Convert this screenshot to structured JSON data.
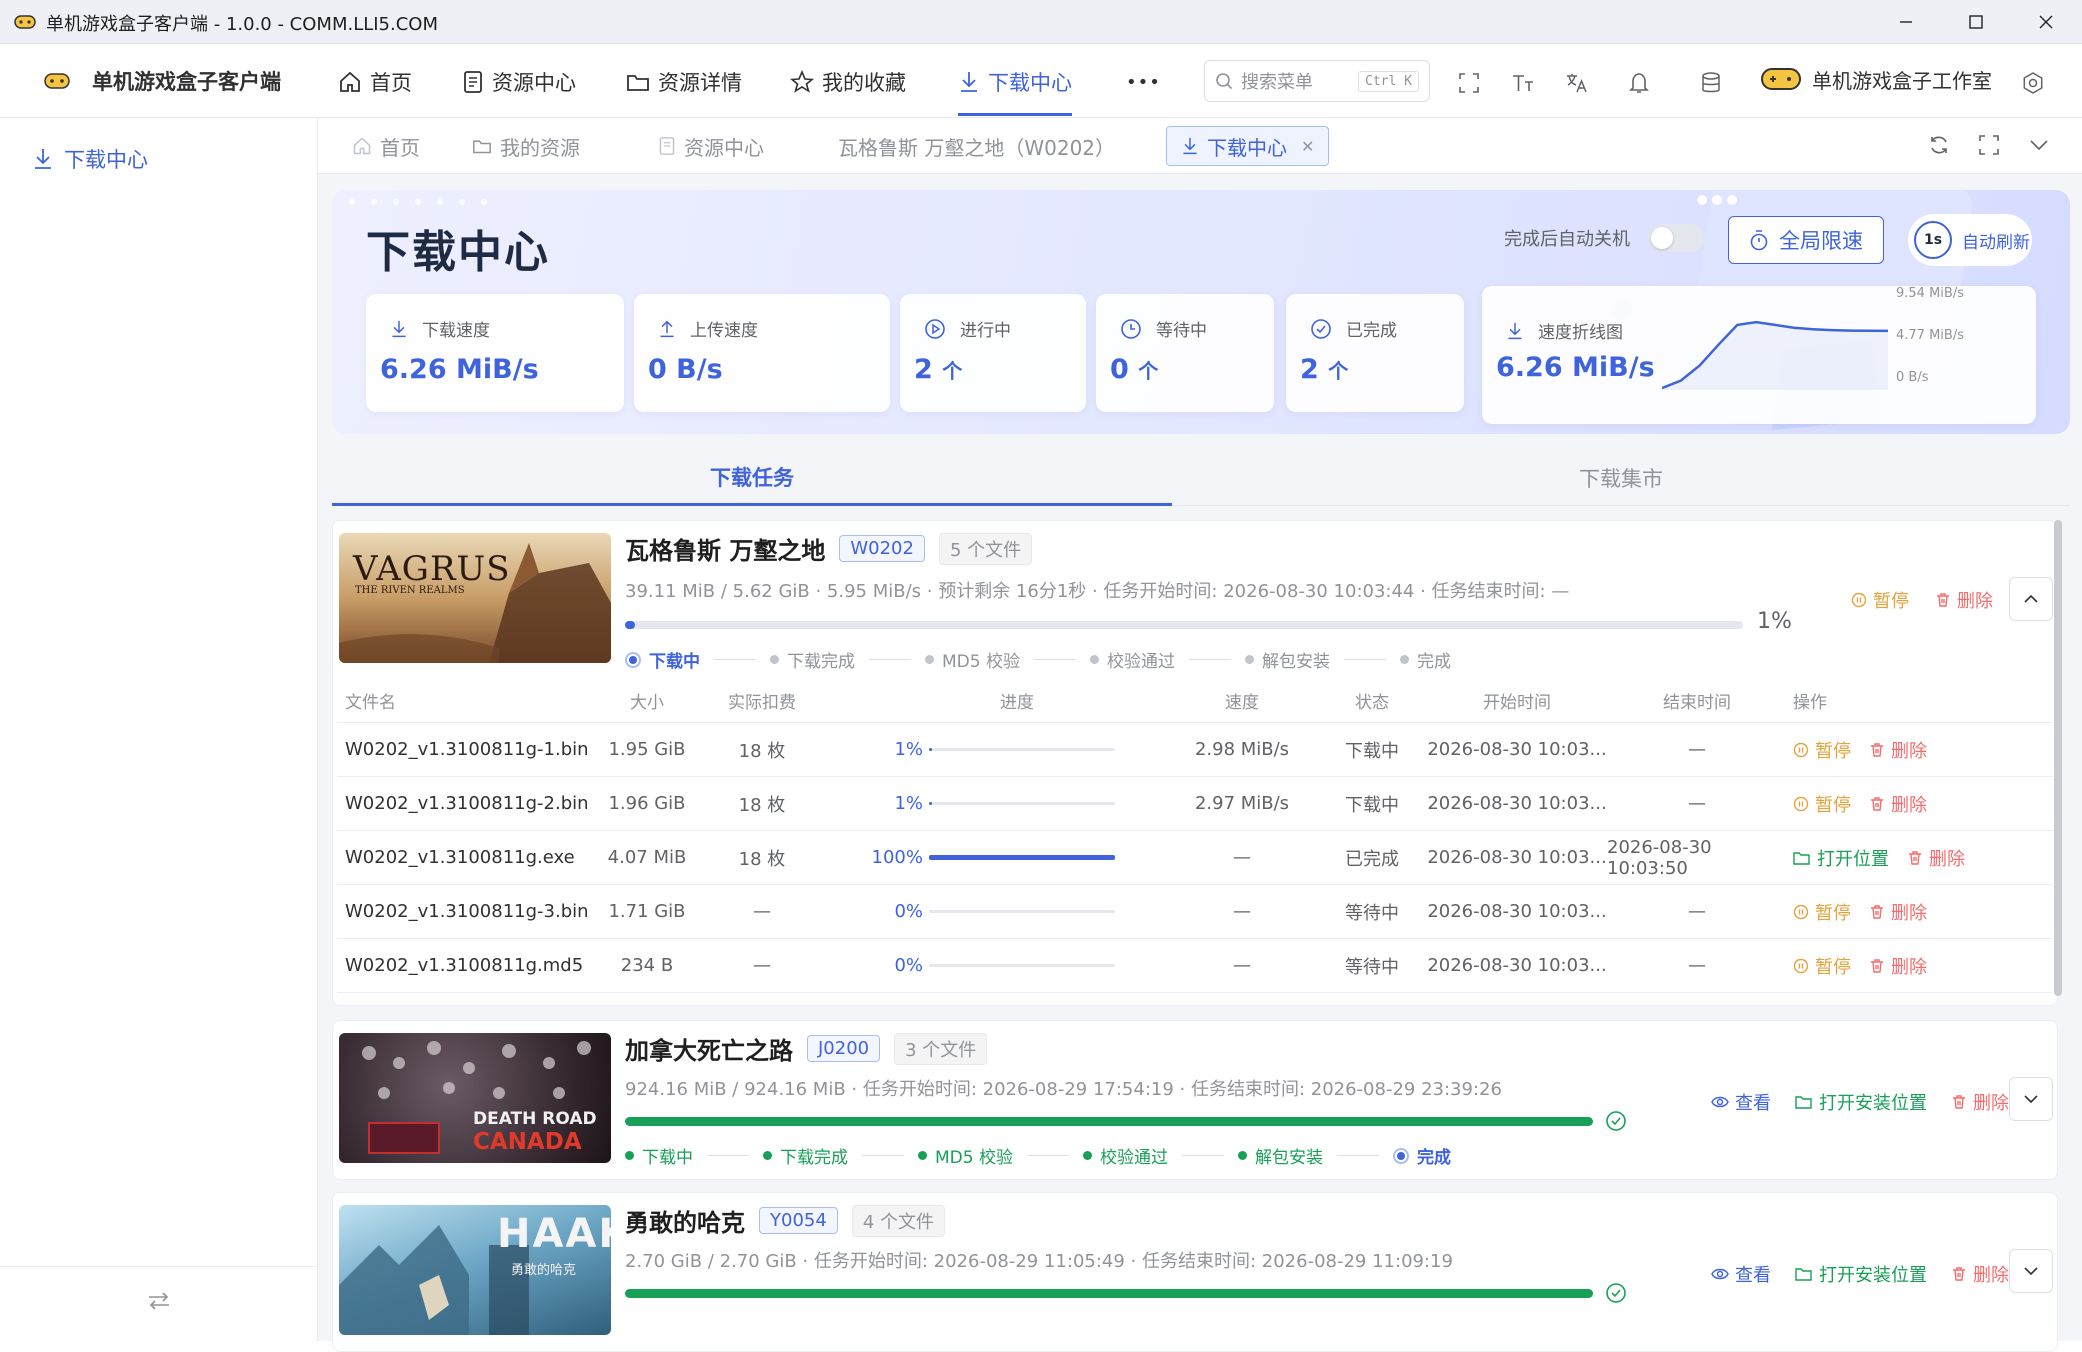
{
  "window": {
    "title": "单机游戏盒子客户端 - 1.0.0 - COMM.LLI5.COM"
  },
  "header": {
    "app_name": "单机游戏盒子客户端",
    "nav": [
      {
        "label": "首页",
        "icon": "home-icon"
      },
      {
        "label": "资源中心",
        "icon": "document-icon"
      },
      {
        "label": "资源详情",
        "icon": "folder-icon"
      },
      {
        "label": "我的收藏",
        "icon": "star-icon"
      },
      {
        "label": "下载中心",
        "icon": "download-icon",
        "active": true
      }
    ],
    "more": "•••",
    "search_placeholder": "搜索菜单",
    "search_shortcut": "Ctrl K",
    "studio_name": "单机游戏盒子工作室"
  },
  "sidebar": {
    "items": [
      {
        "label": "下载中心",
        "icon": "download-icon"
      }
    ]
  },
  "page_tabs": [
    {
      "label": "首页"
    },
    {
      "label": "我的资源"
    },
    {
      "label": "资源中心"
    },
    {
      "label": "瓦格鲁斯 万壑之地（W0202）"
    },
    {
      "label": "下载中心",
      "active": true
    }
  ],
  "hero": {
    "title": "下载中心",
    "auto_shutdown_label": "完成后自动关机",
    "auto_shutdown_on": false,
    "limit_button": "全局限速",
    "refresh_interval": "1s",
    "refresh_label": "自动刷新",
    "stats": {
      "download_speed": {
        "label": "下载速度",
        "value": "6.26 MiB/s"
      },
      "upload_speed": {
        "label": "上传速度",
        "value": "0 B/s"
      },
      "in_progress": {
        "label": "进行中",
        "value": "2",
        "unit": "个"
      },
      "waiting": {
        "label": "等待中",
        "value": "0",
        "unit": "个"
      },
      "completed": {
        "label": "已完成",
        "value": "2",
        "unit": "个"
      }
    },
    "speed_chart": {
      "label": "速度折线图",
      "value": "6.26 MiB/s",
      "ticks": [
        "9.54 MiB/s",
        "4.77 MiB/s",
        "0 B/s"
      ]
    }
  },
  "chart_data": {
    "type": "line",
    "title": "速度折线图",
    "yticks": [
      "9.54 MiB/s",
      "4.77 MiB/s",
      "0 B/s"
    ],
    "ylim": [
      0,
      9.54
    ],
    "series": [
      {
        "values": [
          0.2,
          1.0,
          2.6,
          4.8,
          6.9,
          7.2,
          6.9,
          6.6,
          6.45,
          6.35,
          6.3,
          6.28,
          6.26
        ]
      }
    ]
  },
  "section_tabs": [
    {
      "label": "下载任务",
      "active": true
    },
    {
      "label": "下载集市"
    }
  ],
  "step_labels": [
    "下载中",
    "下载完成",
    "MD5 校验",
    "校验通过",
    "解包安装",
    "完成"
  ],
  "table_headers": [
    "文件名",
    "大小",
    "实际扣费",
    "进度",
    "速度",
    "状态",
    "开始时间",
    "结束时间",
    "操作"
  ],
  "actions": {
    "pause": "暂停",
    "delete": "删除",
    "open_location": "打开位置",
    "view": "查看",
    "open_install": "打开安装位置"
  },
  "tasks": [
    {
      "name": "瓦格鲁斯 万壑之地",
      "code": "W0202",
      "files_count": "5 个文件",
      "thumb_text": "VAGRUS",
      "thumb_sub": "THE RIVEN REALMS",
      "meta": "39.11 MiB / 5.62 GiB · 5.95 MiB/s · 预计剩余 16分1秒 · 任务开始时间: 2026-08-30 10:03:44 · 任务结束时间: —",
      "progress": 0.01,
      "progress_text": "1%",
      "current_step": 0,
      "files": [
        {
          "name": "W0202_v1.3100811g-1.bin",
          "size": "1.95 GiB",
          "fee": "18 枚",
          "pct": "1%",
          "progress": 0.01,
          "speed": "2.98 MiB/s",
          "status": "下载中",
          "start": "2026-08-30 10:03...",
          "end": "—",
          "done": false
        },
        {
          "name": "W0202_v1.3100811g-2.bin",
          "size": "1.96 GiB",
          "fee": "18 枚",
          "pct": "1%",
          "progress": 0.01,
          "speed": "2.97 MiB/s",
          "status": "下载中",
          "start": "2026-08-30 10:03...",
          "end": "—",
          "done": false
        },
        {
          "name": "W0202_v1.3100811g.exe",
          "size": "4.07 MiB",
          "fee": "18 枚",
          "pct": "100%",
          "progress": 1.0,
          "speed": "—",
          "status": "已完成",
          "start": "2026-08-30 10:03...",
          "end": "2026-08-30 10:03:50",
          "done": true
        },
        {
          "name": "W0202_v1.3100811g-3.bin",
          "size": "1.71 GiB",
          "fee": "—",
          "pct": "0%",
          "progress": 0,
          "speed": "—",
          "status": "等待中",
          "start": "2026-08-30 10:03...",
          "end": "—",
          "done": false
        },
        {
          "name": "W0202_v1.3100811g.md5",
          "size": "234 B",
          "fee": "—",
          "pct": "0%",
          "progress": 0,
          "speed": "—",
          "status": "等待中",
          "start": "2026-08-30 10:03...",
          "end": "—",
          "done": false
        }
      ]
    },
    {
      "name": "加拿大死亡之路",
      "code": "J0200",
      "files_count": "3 个文件",
      "thumb_text": "DEATH ROAD",
      "thumb_sub": "CANADA",
      "meta": "924.16 MiB / 924.16 MiB · 任务开始时间: 2026-08-29 17:54:19 · 任务结束时间: 2026-08-29 23:39:26",
      "progress": 1.0,
      "current_step": 5
    },
    {
      "name": "勇敢的哈克",
      "code": "Y0054",
      "files_count": "4 个文件",
      "thumb_text": "HAAK",
      "thumb_sub": "勇敢的哈克",
      "meta": "2.70 GiB / 2.70 GiB · 任务开始时间: 2026-08-29 11:05:49 · 任务结束时间: 2026-08-29 11:09:19",
      "progress": 1.0,
      "current_step": 5
    }
  ],
  "colors": {
    "accent": "#3e63dd",
    "success": "#18a058",
    "warning": "#e6a23c",
    "danger": "#f56c6c"
  }
}
